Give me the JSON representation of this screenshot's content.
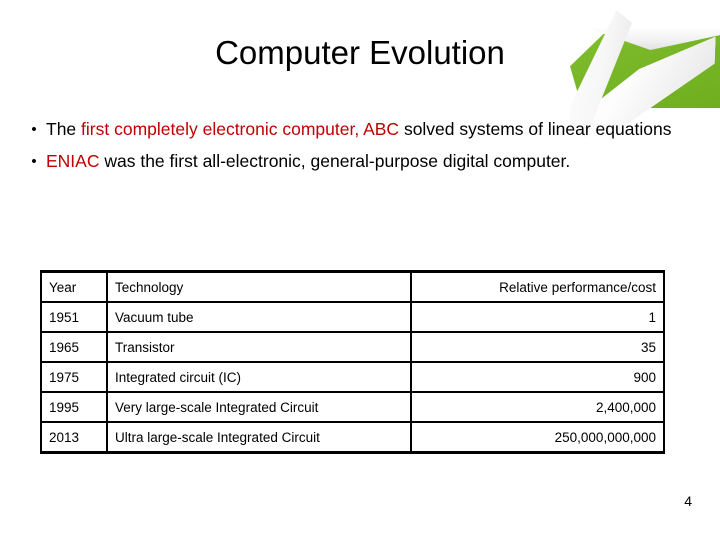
{
  "slide": {
    "title": "Computer Evolution",
    "slide_number": "4",
    "accent_green": "#7ab829",
    "accent_red": "#c00000"
  },
  "bullets": [
    {
      "marker": "•",
      "lead_text": "The ",
      "highlight_text": "first completely electronic computer, ABC",
      "tail_text": " solved systems of linear equations"
    },
    {
      "marker": "•",
      "lead_text": "",
      "highlight_text": "ENIAC",
      "tail_text": " was the first all-electronic, general-purpose digital computer."
    }
  ],
  "table": {
    "headers": {
      "year": "Year",
      "technology": "Technology",
      "performance": "Relative performance/cost"
    },
    "rows": [
      {
        "year": "1951",
        "technology": "Vacuum tube",
        "performance": "1"
      },
      {
        "year": "1965",
        "technology": "Transistor",
        "performance": "35"
      },
      {
        "year": "1975",
        "technology": "Integrated circuit (IC)",
        "performance": "900"
      },
      {
        "year": "1995",
        "technology": "Very large-scale Integrated Circuit",
        "performance": "2,400,000"
      },
      {
        "year": "2013",
        "technology": "Ultra large-scale Integrated Circuit",
        "performance": "250,000,000,000"
      }
    ]
  }
}
